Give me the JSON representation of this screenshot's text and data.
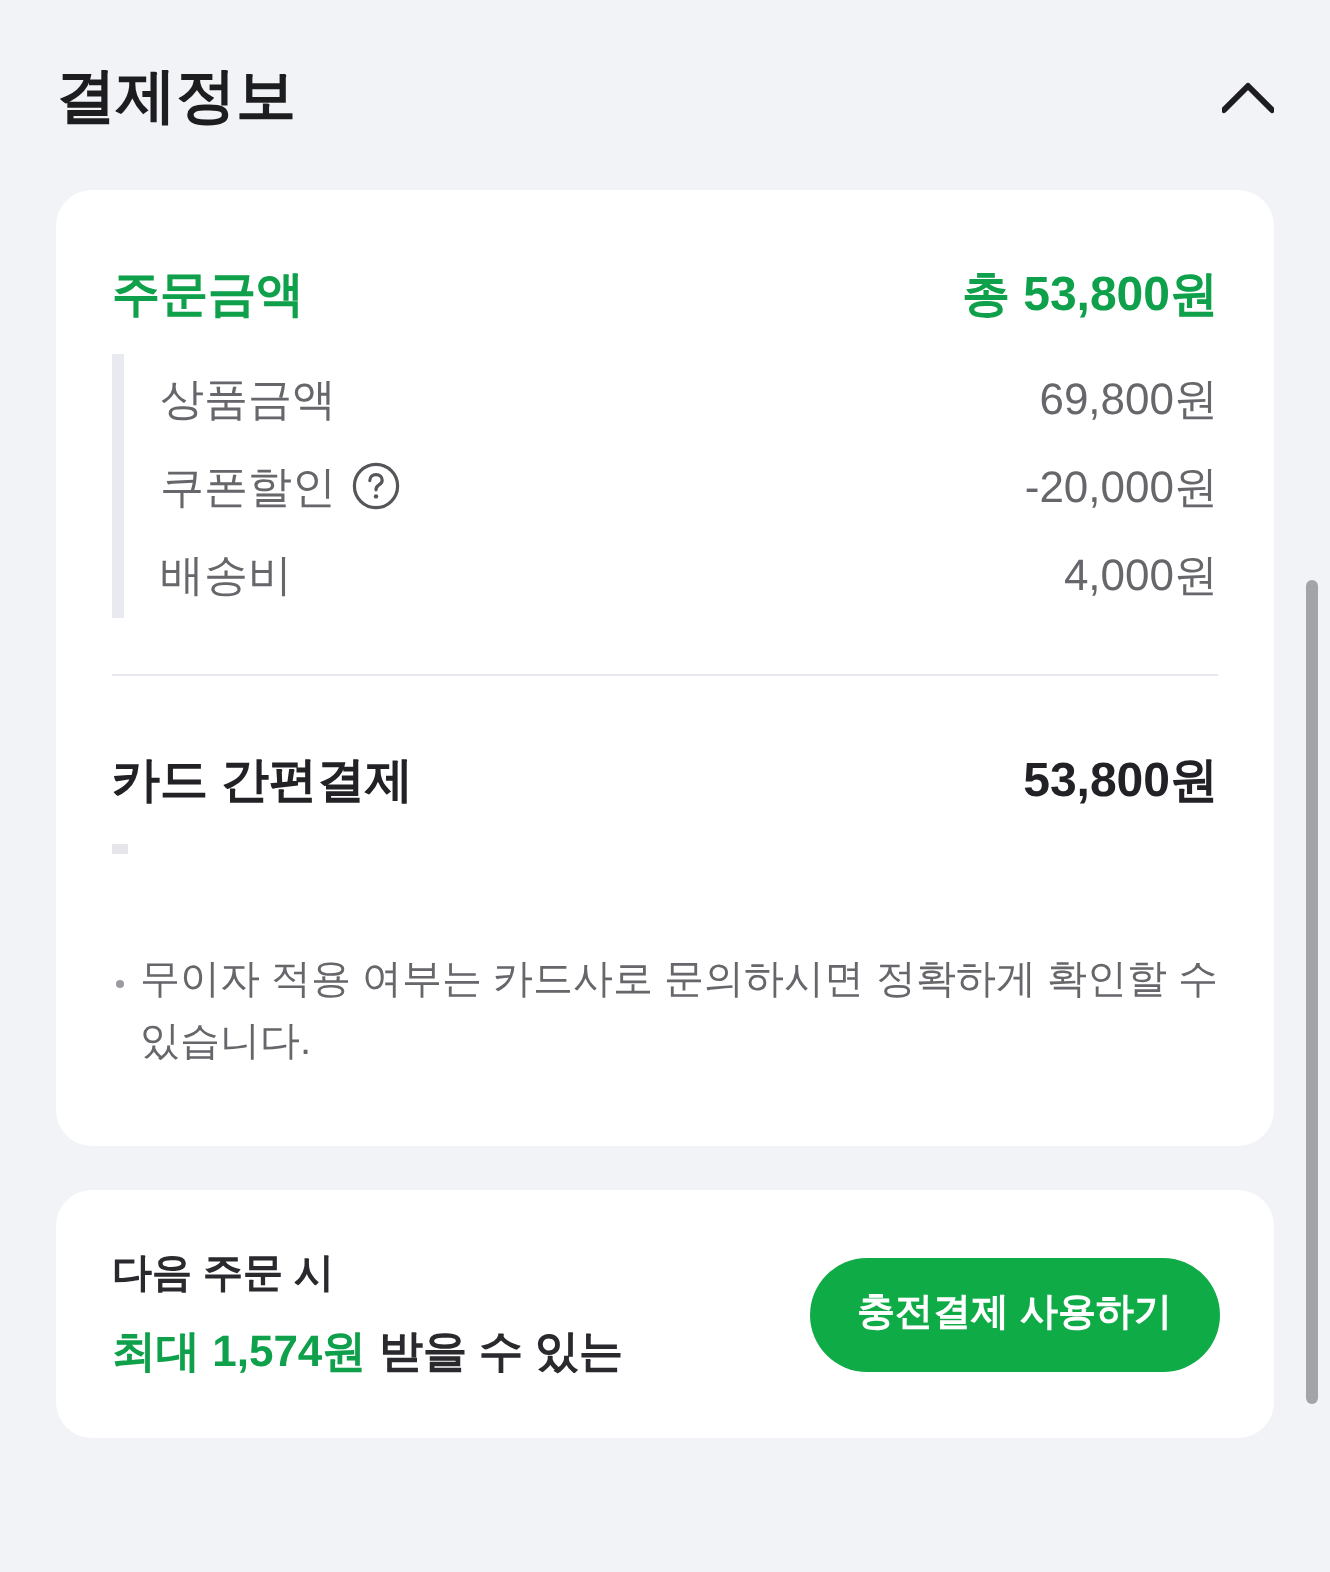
{
  "section": {
    "title": "결제정보",
    "expanded": true
  },
  "order_summary": {
    "label": "주문금액",
    "total": "총 53,800원",
    "items": [
      {
        "label": "상품금액",
        "value": "69,800원",
        "help": false
      },
      {
        "label": "쿠폰할인",
        "value": "-20,000원",
        "help": true
      },
      {
        "label": "배송비",
        "value": "4,000원",
        "help": false
      }
    ]
  },
  "payment": {
    "method": "카드 간편결제",
    "amount": "53,800원"
  },
  "notes": [
    "무이자 적용 여부는 카드사로 문의하시면 정확하게 확인할 수 있습니다."
  ],
  "reward": {
    "line1": "다음 주문 시",
    "line2": "**최대 1,574원** 받을 수 있는",
    "button": "충전결제 사용하기"
  }
}
